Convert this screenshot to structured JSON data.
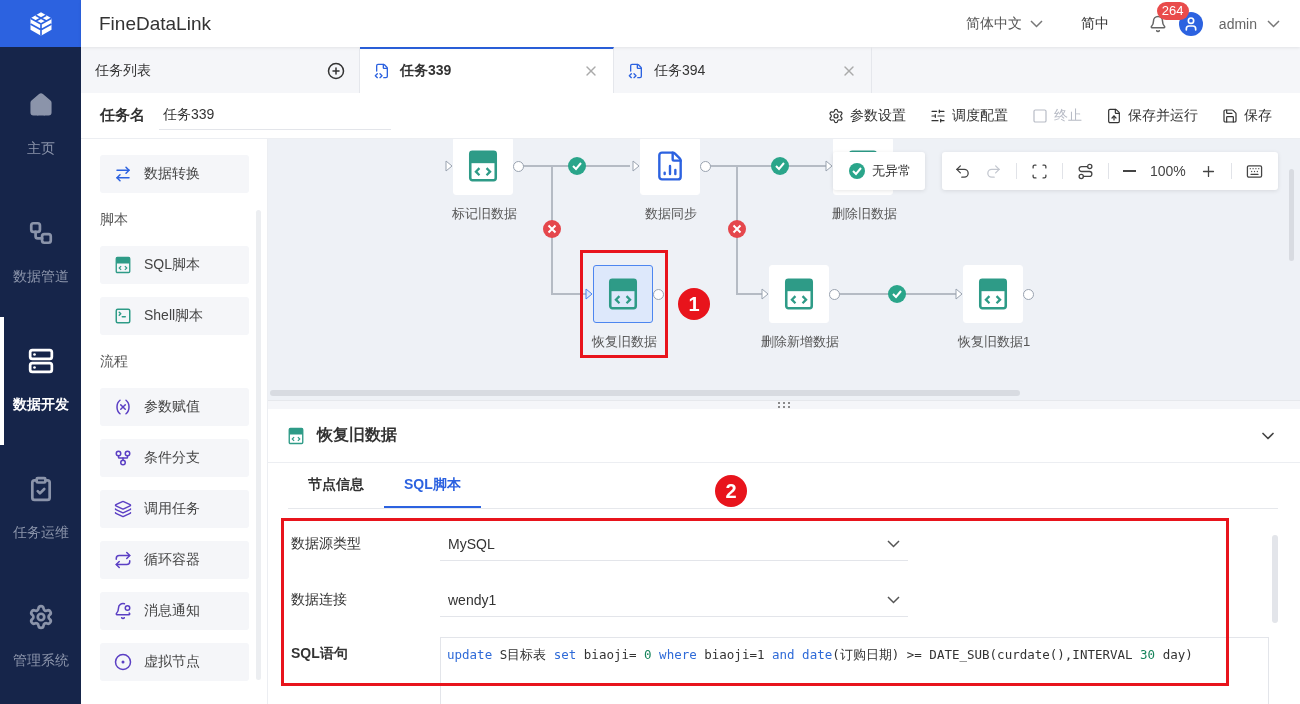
{
  "app": {
    "title": "FineDataLink"
  },
  "header": {
    "language": "简体中文",
    "locale_short": "简中",
    "notifications": "264",
    "user": "admin"
  },
  "nav": [
    {
      "label": "主页",
      "kind": "home",
      "selected": false
    },
    {
      "label": "数据管道",
      "kind": "pipeline",
      "selected": false
    },
    {
      "label": "数据开发",
      "kind": "develop",
      "selected": true
    },
    {
      "label": "任务运维",
      "kind": "ops",
      "selected": false
    },
    {
      "label": "管理系统",
      "kind": "admin",
      "selected": false
    }
  ],
  "tabs": [
    {
      "label": "任务列表",
      "kind": "list",
      "selected": false
    },
    {
      "label": "任务339",
      "kind": "task",
      "selected": true
    },
    {
      "label": "任务394",
      "kind": "task",
      "selected": false
    }
  ],
  "task_name": {
    "label": "任务名",
    "value": "任务339"
  },
  "actions": [
    {
      "label": "参数设置",
      "kind": "params",
      "disabled": false
    },
    {
      "label": "调度配置",
      "kind": "schedule",
      "disabled": false
    },
    {
      "label": "终止",
      "kind": "stop",
      "disabled": true
    },
    {
      "label": "保存并运行",
      "kind": "save-run",
      "disabled": false
    },
    {
      "label": "保存",
      "kind": "save",
      "disabled": false
    }
  ],
  "palette": [
    {
      "items": [
        {
          "label": "数据转换",
          "kind": "transform"
        }
      ]
    },
    {
      "title": "脚本",
      "items": [
        {
          "label": "SQL脚本",
          "kind": "sql"
        },
        {
          "label": "Shell脚本",
          "kind": "shell"
        }
      ]
    },
    {
      "title": "流程",
      "items": [
        {
          "label": "参数赋值",
          "kind": "param"
        },
        {
          "label": "条件分支",
          "kind": "branch"
        },
        {
          "label": "调用任务",
          "kind": "call"
        },
        {
          "label": "循环容器",
          "kind": "loop"
        },
        {
          "label": "消息通知",
          "kind": "notify"
        },
        {
          "label": "虚拟节点",
          "kind": "virtual"
        }
      ]
    }
  ],
  "canvas": {
    "nodes": [
      {
        "label": "标记旧数据",
        "kind": "sql",
        "selected": false
      },
      {
        "label": "数据同步",
        "kind": "sync",
        "selected": false
      },
      {
        "label": "删除旧数据",
        "kind": "sql",
        "selected": false
      },
      {
        "label": "恢复旧数据",
        "kind": "sql",
        "selected": true
      },
      {
        "label": "删除新增数据",
        "kind": "sql",
        "selected": false
      },
      {
        "label": "恢复旧数据1",
        "kind": "sql",
        "selected": false
      }
    ],
    "edges": [
      {
        "failed": false
      },
      {
        "failed": true
      },
      {
        "failed": false
      },
      {
        "failed": true
      },
      {
        "failed": false
      }
    ],
    "status_badge": "无异常",
    "toolbar": {
      "tools": [
        {
          "kind": "undo",
          "disabled": false
        },
        {
          "kind": "redo",
          "disabled": true
        },
        {
          "kind": "fit",
          "disabled": false
        },
        {
          "kind": "line",
          "disabled": false
        },
        {
          "kind": "zoom-out",
          "disabled": false
        },
        {
          "kind": "zoom-label",
          "label": "100%"
        },
        {
          "kind": "zoom-in",
          "disabled": false
        },
        {
          "kind": "keyboard",
          "disabled": false
        }
      ]
    }
  },
  "annotations": [
    {
      "label": "1"
    },
    {
      "label": "2"
    }
  ],
  "detail": {
    "title": "恢复旧数据",
    "tabs": [
      {
        "label": "节点信息",
        "selected": false
      },
      {
        "label": "SQL脚本",
        "selected": true
      }
    ],
    "fields": [
      {
        "label": "数据源类型",
        "value": "MySQL"
      },
      {
        "label": "数据连接",
        "value": "wendy1"
      }
    ],
    "sql": {
      "label": "SQL语句",
      "tokens": [
        {
          "kind": "keyword",
          "text": "update"
        },
        {
          "kind": "text",
          "text": " S目标表 "
        },
        {
          "kind": "keyword",
          "text": "set"
        },
        {
          "kind": "text",
          "text": " biaoji= "
        },
        {
          "kind": "number",
          "text": "0"
        },
        {
          "kind": "keyword",
          "text": " where"
        },
        {
          "kind": "text",
          "text": " biaoji=1 "
        },
        {
          "kind": "keyword",
          "text": "and date"
        },
        {
          "kind": "text",
          "text": "(订购日期) >= DATE_SUB(curdate(),INTERVAL "
        },
        {
          "kind": "number",
          "text": "30"
        },
        {
          "kind": "text",
          "text": " day)"
        }
      ]
    }
  }
}
